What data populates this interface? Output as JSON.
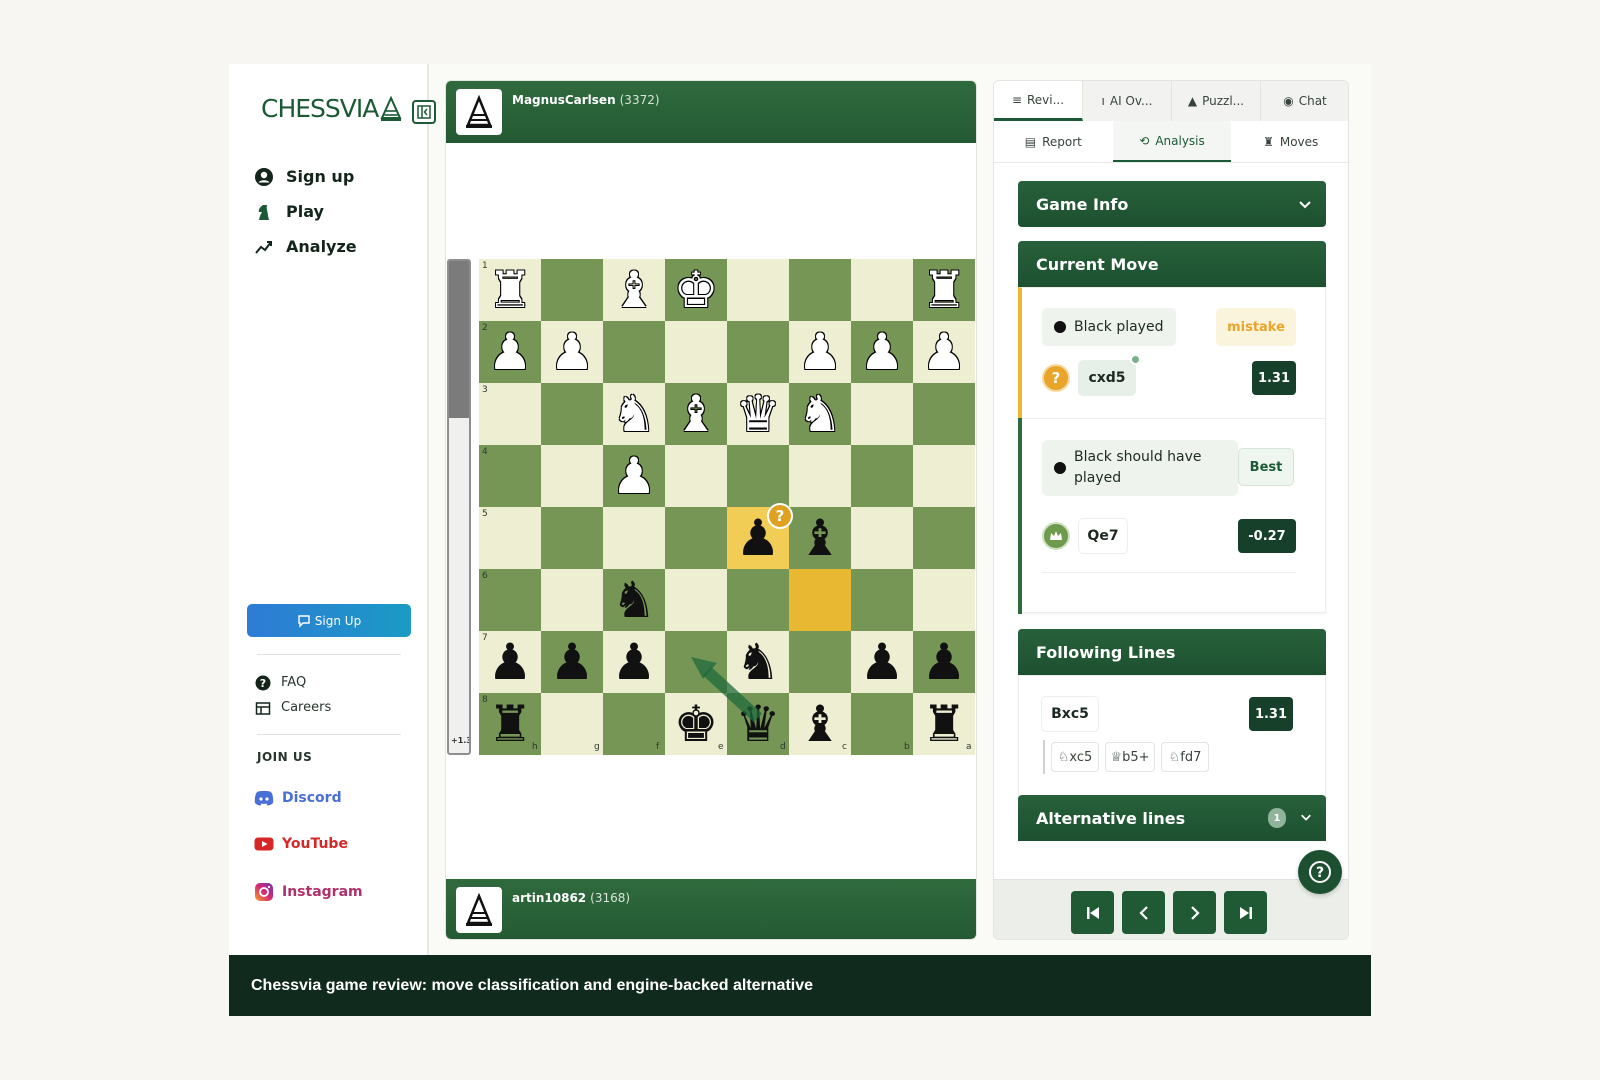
{
  "brand": {
    "logo_text": "CHESSVIA"
  },
  "sidebar": {
    "nav": [
      {
        "label": "Sign up",
        "icon": "user-circle-icon"
      },
      {
        "label": "Play",
        "icon": "knight-icon"
      },
      {
        "label": "Analyze",
        "icon": "trend-chart-icon"
      }
    ],
    "signup_cta": "Sign Up",
    "links": [
      {
        "label": "FAQ",
        "icon": "question-icon"
      },
      {
        "label": "Careers",
        "icon": "briefcase-icon"
      }
    ],
    "join_us": "JOIN US",
    "social": [
      {
        "label": "Discord",
        "icon": "discord-icon",
        "color": "#4a6fd6"
      },
      {
        "label": "YouTube",
        "icon": "youtube-icon",
        "color": "#d62828"
      },
      {
        "label": "Instagram",
        "icon": "instagram-icon",
        "color": "#b0306a"
      }
    ]
  },
  "players": {
    "top": {
      "name": "MagnusCarlsen",
      "rating": "(3372)"
    },
    "bottom": {
      "name": "artin10862",
      "rating": "(3168)"
    }
  },
  "board": {
    "eval_label": "+1.3",
    "eval_black_fraction": 0.32,
    "rank_labels": [
      "1",
      "2",
      "3",
      "4",
      "5",
      "6",
      "7",
      "8"
    ],
    "file_labels": [
      "h",
      "g",
      "f",
      "e",
      "d",
      "c",
      "b",
      "a"
    ],
    "pieces": [
      {
        "r": 0,
        "c": 0,
        "p": "♜",
        "side": "w"
      },
      {
        "r": 0,
        "c": 2,
        "p": "♝",
        "side": "w"
      },
      {
        "r": 0,
        "c": 3,
        "p": "♚",
        "side": "w"
      },
      {
        "r": 0,
        "c": 7,
        "p": "♜",
        "side": "w"
      },
      {
        "r": 1,
        "c": 0,
        "p": "♟",
        "side": "w"
      },
      {
        "r": 1,
        "c": 1,
        "p": "♟",
        "side": "w"
      },
      {
        "r": 1,
        "c": 5,
        "p": "♟",
        "side": "w"
      },
      {
        "r": 1,
        "c": 6,
        "p": "♟",
        "side": "w"
      },
      {
        "r": 1,
        "c": 7,
        "p": "♟",
        "side": "w"
      },
      {
        "r": 2,
        "c": 2,
        "p": "♞",
        "side": "w"
      },
      {
        "r": 2,
        "c": 3,
        "p": "♝",
        "side": "w"
      },
      {
        "r": 2,
        "c": 4,
        "p": "♛",
        "side": "w"
      },
      {
        "r": 2,
        "c": 5,
        "p": "♞",
        "side": "w"
      },
      {
        "r": 3,
        "c": 2,
        "p": "♟",
        "side": "w"
      },
      {
        "r": 4,
        "c": 4,
        "p": "♟",
        "side": "b"
      },
      {
        "r": 4,
        "c": 5,
        "p": "♝",
        "side": "b"
      },
      {
        "r": 5,
        "c": 2,
        "p": "♞",
        "side": "b"
      },
      {
        "r": 6,
        "c": 0,
        "p": "♟",
        "side": "b"
      },
      {
        "r": 6,
        "c": 1,
        "p": "♟",
        "side": "b"
      },
      {
        "r": 6,
        "c": 2,
        "p": "♟",
        "side": "b"
      },
      {
        "r": 6,
        "c": 4,
        "p": "♞",
        "side": "b"
      },
      {
        "r": 6,
        "c": 6,
        "p": "♟",
        "side": "b"
      },
      {
        "r": 6,
        "c": 7,
        "p": "♟",
        "side": "b"
      },
      {
        "r": 7,
        "c": 0,
        "p": "♜",
        "side": "b"
      },
      {
        "r": 7,
        "c": 3,
        "p": "♚",
        "side": "b"
      },
      {
        "r": 7,
        "c": 4,
        "p": "♛",
        "side": "b"
      },
      {
        "r": 7,
        "c": 5,
        "p": "♝",
        "side": "b"
      },
      {
        "r": 7,
        "c": 7,
        "p": "♜",
        "side": "b"
      }
    ],
    "highlight_from": {
      "r": 4,
      "c": 4
    },
    "highlight_to": {
      "r": 5,
      "c": 5
    },
    "mistake_badge": "?"
  },
  "tabs": [
    {
      "label": "Revi...",
      "icon": "≡",
      "active": true
    },
    {
      "label": "AI Ov...",
      "icon": "ı",
      "active": false
    },
    {
      "label": "Puzzl...",
      "icon": "▲",
      "active": false
    },
    {
      "label": "Chat",
      "icon": "◉",
      "active": false
    }
  ],
  "subtabs": [
    {
      "label": "Report",
      "icon": "▤",
      "active": false
    },
    {
      "label": "Analysis",
      "icon": "⟲",
      "active": true
    },
    {
      "label": "Moves",
      "icon": "♜",
      "active": false
    }
  ],
  "game_info": {
    "title": "Game Info"
  },
  "current_move": {
    "title": "Current Move",
    "played_label": "Black played",
    "classification": "mistake",
    "played_move": "cxd5",
    "played_score": "1.31",
    "should_label": "Black should have played",
    "best_tag": "Best",
    "best_move": "Qe7",
    "best_score": "-0.27",
    "accent_mistake": "#e8a52a"
  },
  "following_lines": {
    "title": "Following Lines",
    "main_move": "Bxc5",
    "main_score": "1.31",
    "continuations": [
      "♘xc5",
      "♕b5+",
      "♘fd7"
    ]
  },
  "alternative_lines": {
    "title": "Alternative lines",
    "count": "1"
  },
  "caption": "Chessvia game review: move classification and engine-backed alternative"
}
